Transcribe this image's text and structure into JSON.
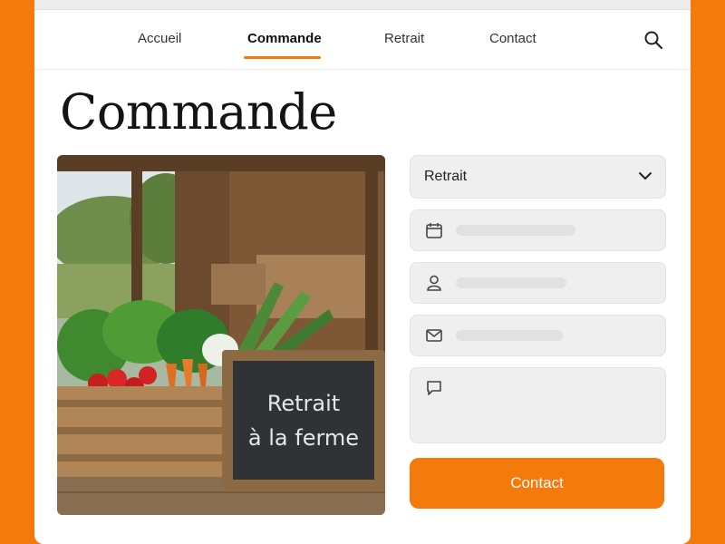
{
  "nav": {
    "items": [
      {
        "label": "Accueil"
      },
      {
        "label": "Commande"
      },
      {
        "label": "Retrait"
      },
      {
        "label": "Contact"
      }
    ],
    "active": "Commande",
    "search_icon": "search-icon"
  },
  "page": {
    "title": "Commande"
  },
  "photo": {
    "chalkboard_line1": "Retrait",
    "chalkboard_line2": "à la ferme"
  },
  "form": {
    "select_value": "Retrait",
    "fields": [
      {
        "icon": "calendar-icon"
      },
      {
        "icon": "user-icon"
      },
      {
        "icon": "mail-icon"
      },
      {
        "icon": "message-icon"
      }
    ],
    "submit_label": "Contact"
  },
  "colors": {
    "accent": "#f47a0b",
    "background": "#f47a0b",
    "field_bg": "#efefef"
  }
}
